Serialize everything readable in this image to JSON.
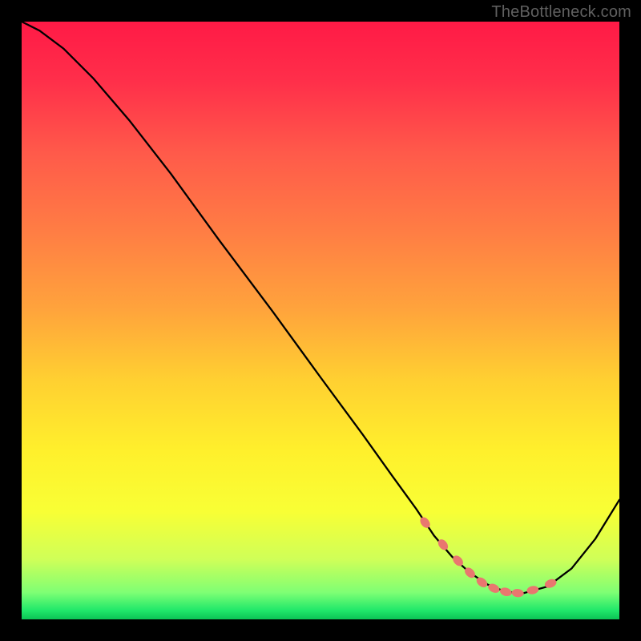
{
  "watermark": "TheBottleneck.com",
  "colors": {
    "background": "#000000",
    "watermark_text": "#606060",
    "curve_stroke": "#000000",
    "marker_fill": "#e9776f",
    "marker_stroke": "#b94b45",
    "gradient_stops": [
      {
        "offset": 0.0,
        "color": "#ff1a46"
      },
      {
        "offset": 0.1,
        "color": "#ff2f4a"
      },
      {
        "offset": 0.22,
        "color": "#ff5a4a"
      },
      {
        "offset": 0.35,
        "color": "#ff7d44"
      },
      {
        "offset": 0.48,
        "color": "#ffa33c"
      },
      {
        "offset": 0.6,
        "color": "#ffd031"
      },
      {
        "offset": 0.72,
        "color": "#fff02c"
      },
      {
        "offset": 0.82,
        "color": "#f8ff35"
      },
      {
        "offset": 0.9,
        "color": "#cfff58"
      },
      {
        "offset": 0.955,
        "color": "#7eff74"
      },
      {
        "offset": 0.985,
        "color": "#20e86a"
      },
      {
        "offset": 1.0,
        "color": "#0bc455"
      }
    ]
  },
  "chart_data": {
    "type": "line",
    "title": "",
    "xlabel": "",
    "ylabel": "",
    "xlim": [
      0,
      100
    ],
    "ylim": [
      0,
      100
    ],
    "grid": false,
    "legend": false,
    "series": [
      {
        "name": "curve",
        "x": [
          0,
          3,
          7,
          12,
          18,
          25,
          33,
          42,
          50,
          57,
          62,
          66,
          69,
          72,
          75,
          78,
          81,
          84,
          88,
          92,
          96,
          100
        ],
        "y": [
          100,
          98.5,
          95.5,
          90.5,
          83.5,
          74.5,
          63.5,
          51.5,
          40.5,
          31,
          24,
          18.5,
          14,
          10.5,
          7.8,
          5.8,
          4.6,
          4.4,
          5.5,
          8.5,
          13.5,
          20
        ],
        "stroke": "#000000",
        "stroke_width": 2.3
      }
    ],
    "markers": {
      "name": "highlight-dots",
      "x": [
        67.5,
        70.5,
        73,
        75,
        77,
        79,
        81,
        83,
        85.5,
        88.5
      ],
      "y": [
        16.2,
        12.5,
        9.8,
        7.8,
        6.2,
        5.2,
        4.6,
        4.4,
        4.9,
        6.0
      ],
      "fill": "#e9776f",
      "radius": 6
    }
  }
}
